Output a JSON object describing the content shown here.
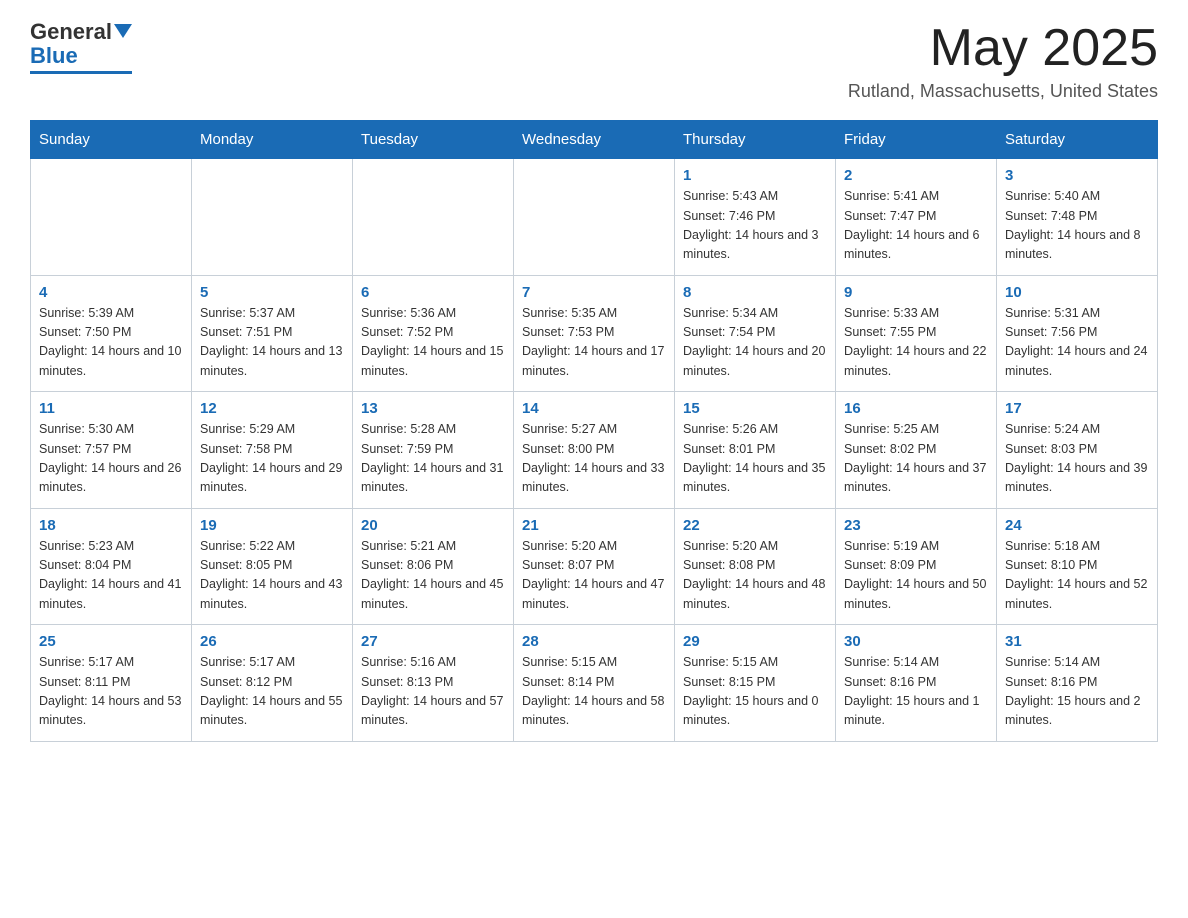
{
  "header": {
    "logo_general": "General",
    "logo_blue": "Blue",
    "month_title": "May 2025",
    "location": "Rutland, Massachusetts, United States"
  },
  "days_of_week": [
    "Sunday",
    "Monday",
    "Tuesday",
    "Wednesday",
    "Thursday",
    "Friday",
    "Saturday"
  ],
  "weeks": [
    [
      {
        "day": "",
        "sunrise": "",
        "sunset": "",
        "daylight": ""
      },
      {
        "day": "",
        "sunrise": "",
        "sunset": "",
        "daylight": ""
      },
      {
        "day": "",
        "sunrise": "",
        "sunset": "",
        "daylight": ""
      },
      {
        "day": "",
        "sunrise": "",
        "sunset": "",
        "daylight": ""
      },
      {
        "day": "1",
        "sunrise": "Sunrise: 5:43 AM",
        "sunset": "Sunset: 7:46 PM",
        "daylight": "Daylight: 14 hours and 3 minutes."
      },
      {
        "day": "2",
        "sunrise": "Sunrise: 5:41 AM",
        "sunset": "Sunset: 7:47 PM",
        "daylight": "Daylight: 14 hours and 6 minutes."
      },
      {
        "day": "3",
        "sunrise": "Sunrise: 5:40 AM",
        "sunset": "Sunset: 7:48 PM",
        "daylight": "Daylight: 14 hours and 8 minutes."
      }
    ],
    [
      {
        "day": "4",
        "sunrise": "Sunrise: 5:39 AM",
        "sunset": "Sunset: 7:50 PM",
        "daylight": "Daylight: 14 hours and 10 minutes."
      },
      {
        "day": "5",
        "sunrise": "Sunrise: 5:37 AM",
        "sunset": "Sunset: 7:51 PM",
        "daylight": "Daylight: 14 hours and 13 minutes."
      },
      {
        "day": "6",
        "sunrise": "Sunrise: 5:36 AM",
        "sunset": "Sunset: 7:52 PM",
        "daylight": "Daylight: 14 hours and 15 minutes."
      },
      {
        "day": "7",
        "sunrise": "Sunrise: 5:35 AM",
        "sunset": "Sunset: 7:53 PM",
        "daylight": "Daylight: 14 hours and 17 minutes."
      },
      {
        "day": "8",
        "sunrise": "Sunrise: 5:34 AM",
        "sunset": "Sunset: 7:54 PM",
        "daylight": "Daylight: 14 hours and 20 minutes."
      },
      {
        "day": "9",
        "sunrise": "Sunrise: 5:33 AM",
        "sunset": "Sunset: 7:55 PM",
        "daylight": "Daylight: 14 hours and 22 minutes."
      },
      {
        "day": "10",
        "sunrise": "Sunrise: 5:31 AM",
        "sunset": "Sunset: 7:56 PM",
        "daylight": "Daylight: 14 hours and 24 minutes."
      }
    ],
    [
      {
        "day": "11",
        "sunrise": "Sunrise: 5:30 AM",
        "sunset": "Sunset: 7:57 PM",
        "daylight": "Daylight: 14 hours and 26 minutes."
      },
      {
        "day": "12",
        "sunrise": "Sunrise: 5:29 AM",
        "sunset": "Sunset: 7:58 PM",
        "daylight": "Daylight: 14 hours and 29 minutes."
      },
      {
        "day": "13",
        "sunrise": "Sunrise: 5:28 AM",
        "sunset": "Sunset: 7:59 PM",
        "daylight": "Daylight: 14 hours and 31 minutes."
      },
      {
        "day": "14",
        "sunrise": "Sunrise: 5:27 AM",
        "sunset": "Sunset: 8:00 PM",
        "daylight": "Daylight: 14 hours and 33 minutes."
      },
      {
        "day": "15",
        "sunrise": "Sunrise: 5:26 AM",
        "sunset": "Sunset: 8:01 PM",
        "daylight": "Daylight: 14 hours and 35 minutes."
      },
      {
        "day": "16",
        "sunrise": "Sunrise: 5:25 AM",
        "sunset": "Sunset: 8:02 PM",
        "daylight": "Daylight: 14 hours and 37 minutes."
      },
      {
        "day": "17",
        "sunrise": "Sunrise: 5:24 AM",
        "sunset": "Sunset: 8:03 PM",
        "daylight": "Daylight: 14 hours and 39 minutes."
      }
    ],
    [
      {
        "day": "18",
        "sunrise": "Sunrise: 5:23 AM",
        "sunset": "Sunset: 8:04 PM",
        "daylight": "Daylight: 14 hours and 41 minutes."
      },
      {
        "day": "19",
        "sunrise": "Sunrise: 5:22 AM",
        "sunset": "Sunset: 8:05 PM",
        "daylight": "Daylight: 14 hours and 43 minutes."
      },
      {
        "day": "20",
        "sunrise": "Sunrise: 5:21 AM",
        "sunset": "Sunset: 8:06 PM",
        "daylight": "Daylight: 14 hours and 45 minutes."
      },
      {
        "day": "21",
        "sunrise": "Sunrise: 5:20 AM",
        "sunset": "Sunset: 8:07 PM",
        "daylight": "Daylight: 14 hours and 47 minutes."
      },
      {
        "day": "22",
        "sunrise": "Sunrise: 5:20 AM",
        "sunset": "Sunset: 8:08 PM",
        "daylight": "Daylight: 14 hours and 48 minutes."
      },
      {
        "day": "23",
        "sunrise": "Sunrise: 5:19 AM",
        "sunset": "Sunset: 8:09 PM",
        "daylight": "Daylight: 14 hours and 50 minutes."
      },
      {
        "day": "24",
        "sunrise": "Sunrise: 5:18 AM",
        "sunset": "Sunset: 8:10 PM",
        "daylight": "Daylight: 14 hours and 52 minutes."
      }
    ],
    [
      {
        "day": "25",
        "sunrise": "Sunrise: 5:17 AM",
        "sunset": "Sunset: 8:11 PM",
        "daylight": "Daylight: 14 hours and 53 minutes."
      },
      {
        "day": "26",
        "sunrise": "Sunrise: 5:17 AM",
        "sunset": "Sunset: 8:12 PM",
        "daylight": "Daylight: 14 hours and 55 minutes."
      },
      {
        "day": "27",
        "sunrise": "Sunrise: 5:16 AM",
        "sunset": "Sunset: 8:13 PM",
        "daylight": "Daylight: 14 hours and 57 minutes."
      },
      {
        "day": "28",
        "sunrise": "Sunrise: 5:15 AM",
        "sunset": "Sunset: 8:14 PM",
        "daylight": "Daylight: 14 hours and 58 minutes."
      },
      {
        "day": "29",
        "sunrise": "Sunrise: 5:15 AM",
        "sunset": "Sunset: 8:15 PM",
        "daylight": "Daylight: 15 hours and 0 minutes."
      },
      {
        "day": "30",
        "sunrise": "Sunrise: 5:14 AM",
        "sunset": "Sunset: 8:16 PM",
        "daylight": "Daylight: 15 hours and 1 minute."
      },
      {
        "day": "31",
        "sunrise": "Sunrise: 5:14 AM",
        "sunset": "Sunset: 8:16 PM",
        "daylight": "Daylight: 15 hours and 2 minutes."
      }
    ]
  ]
}
